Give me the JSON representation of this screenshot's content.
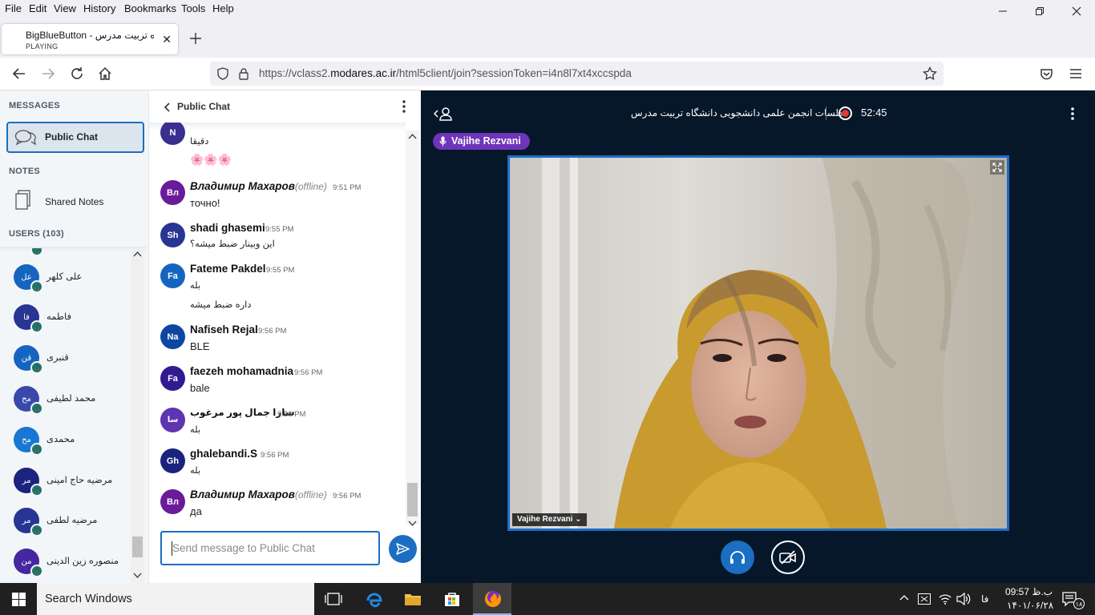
{
  "menu": [
    "File",
    "Edit",
    "View",
    "History",
    "Bookmarks",
    "Tools",
    "Help"
  ],
  "tab": {
    "title": "BigBlueButton - گاه تربیت مدرس",
    "status": "PLAYING"
  },
  "url": {
    "prefix": "https://vclass2.",
    "domain": "modares.ac.ir",
    "path": "/html5client/join?sessionToken=i4n8l7xt4xccspda"
  },
  "sidebar": {
    "messages_heading": "MESSAGES",
    "public_chat": "Public Chat",
    "notes_heading": "NOTES",
    "shared_notes": "Shared Notes",
    "users_heading": "USERS (103)",
    "users": [
      {
        "initials": "عل",
        "name": "علی کلهر",
        "color": "#1565c0"
      },
      {
        "initials": "فا",
        "name": "فاطمه",
        "color": "#283593"
      },
      {
        "initials": "قن",
        "name": "قنبری",
        "color": "#1565c0"
      },
      {
        "initials": "مح",
        "name": "محمد لطیفی",
        "color": "#3949ab"
      },
      {
        "initials": "مح",
        "name": "محمدی",
        "color": "#1976d2"
      },
      {
        "initials": "مر",
        "name": "مرضیه حاج امینی",
        "color": "#1a237e"
      },
      {
        "initials": "مر",
        "name": "مرضیه لطفی",
        "color": "#283593"
      },
      {
        "initials": "من",
        "name": "منصوره زین الدینی",
        "color": "#4527a0"
      }
    ]
  },
  "chat": {
    "title": "Public Chat",
    "placeholder": "Send message to Public Chat",
    "messages": [
      {
        "initials": "N",
        "color": "#3a2f8f",
        "name": "",
        "time": "",
        "lines": [
          "دقیقا",
          "🌸🌸🌸"
        ]
      },
      {
        "initials": "Вл",
        "color": "#6a1b9a",
        "name": "Владимир Махаров",
        "offline": "(offline)",
        "time": "9:51 PM",
        "lines": [
          "точно!"
        ]
      },
      {
        "initials": "Sh",
        "color": "#283593",
        "name": "shadi ghasemi",
        "time": "9:55 PM",
        "lines": [
          "این وبینار ضبط میشه؟"
        ]
      },
      {
        "initials": "Fa",
        "color": "#1565c0",
        "name": "Fateme Pakdel",
        "time": "9:55 PM",
        "lines": [
          "بله",
          "داره ضبط میشه"
        ]
      },
      {
        "initials": "Na",
        "color": "#0d47a1",
        "name": "Nafiseh Rejal",
        "time": "9:56 PM",
        "lines": [
          "BLE"
        ]
      },
      {
        "initials": "Fa",
        "color": "#311b92",
        "name": "faezeh mohamadnia",
        "time": "9:56 PM",
        "lines": [
          "bale"
        ]
      },
      {
        "initials": "سا",
        "color": "#5e35b1",
        "name": "سارا جمال پور مرغوب",
        "time": "9:56 PM",
        "lines": [
          "بله"
        ]
      },
      {
        "initials": "Gh",
        "color": "#1a237e",
        "name": "ghalebandi.S",
        "time": "9:56 PM",
        "lines": [
          "بله"
        ]
      },
      {
        "initials": "Вл",
        "color": "#6a1b9a",
        "name": "Владимир Махаров",
        "offline": "(offline)",
        "time": "9:56 PM",
        "lines": [
          "да"
        ]
      }
    ]
  },
  "stage": {
    "title": "جلسات انجمن علمی دانشجویی دانشگاه تربیت مدرس",
    "timer": "52:45",
    "talker": "Vajihe Rezvani",
    "video_name": "Vajihe Rezvani"
  },
  "taskbar": {
    "search": "Search Windows",
    "lang": "فا",
    "time": "09:57 ب.ظ",
    "date": "۱۴۰۱/۰۶/۲۸",
    "notify": "۱۸"
  },
  "colors": {
    "accent": "#1b6ec2",
    "stage_bg": "#06172a",
    "talker": "#6e34b9",
    "record": "#e53935"
  }
}
